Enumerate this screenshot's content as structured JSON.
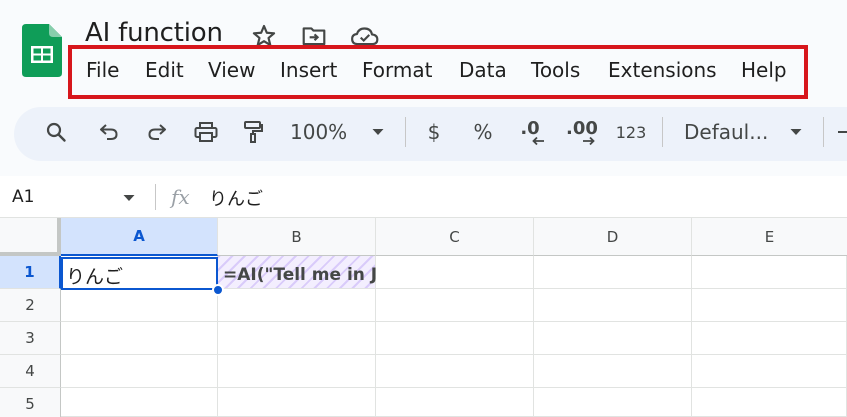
{
  "app": {
    "doc_title": "AI function",
    "icons": [
      "sheets-logo",
      "star-icon",
      "move-folder-icon",
      "cloud-saved-icon"
    ],
    "highlight_color": "#d7161c"
  },
  "menu": {
    "items": [
      "File",
      "Edit",
      "View",
      "Insert",
      "Format",
      "Data",
      "Tools",
      "Extensions",
      "Help"
    ]
  },
  "toolbar": {
    "zoom": "100%",
    "currency_label": "$",
    "percent_label": "%",
    "decrease_decimal_label": ".0",
    "increase_decimal_label": ".00",
    "number_format_label": "123",
    "font_label": "Defaul..."
  },
  "formula_bar": {
    "name_box": "A1",
    "fx_label": "fx",
    "content": "りんご"
  },
  "grid": {
    "columns": [
      "A",
      "B",
      "C",
      "D",
      "E"
    ],
    "rows": [
      "1",
      "2",
      "3",
      "4",
      "5"
    ],
    "selected_cell": "A1",
    "cells": {
      "A1": "りんご",
      "B1": "=AI(\"Tell me in J"
    }
  }
}
